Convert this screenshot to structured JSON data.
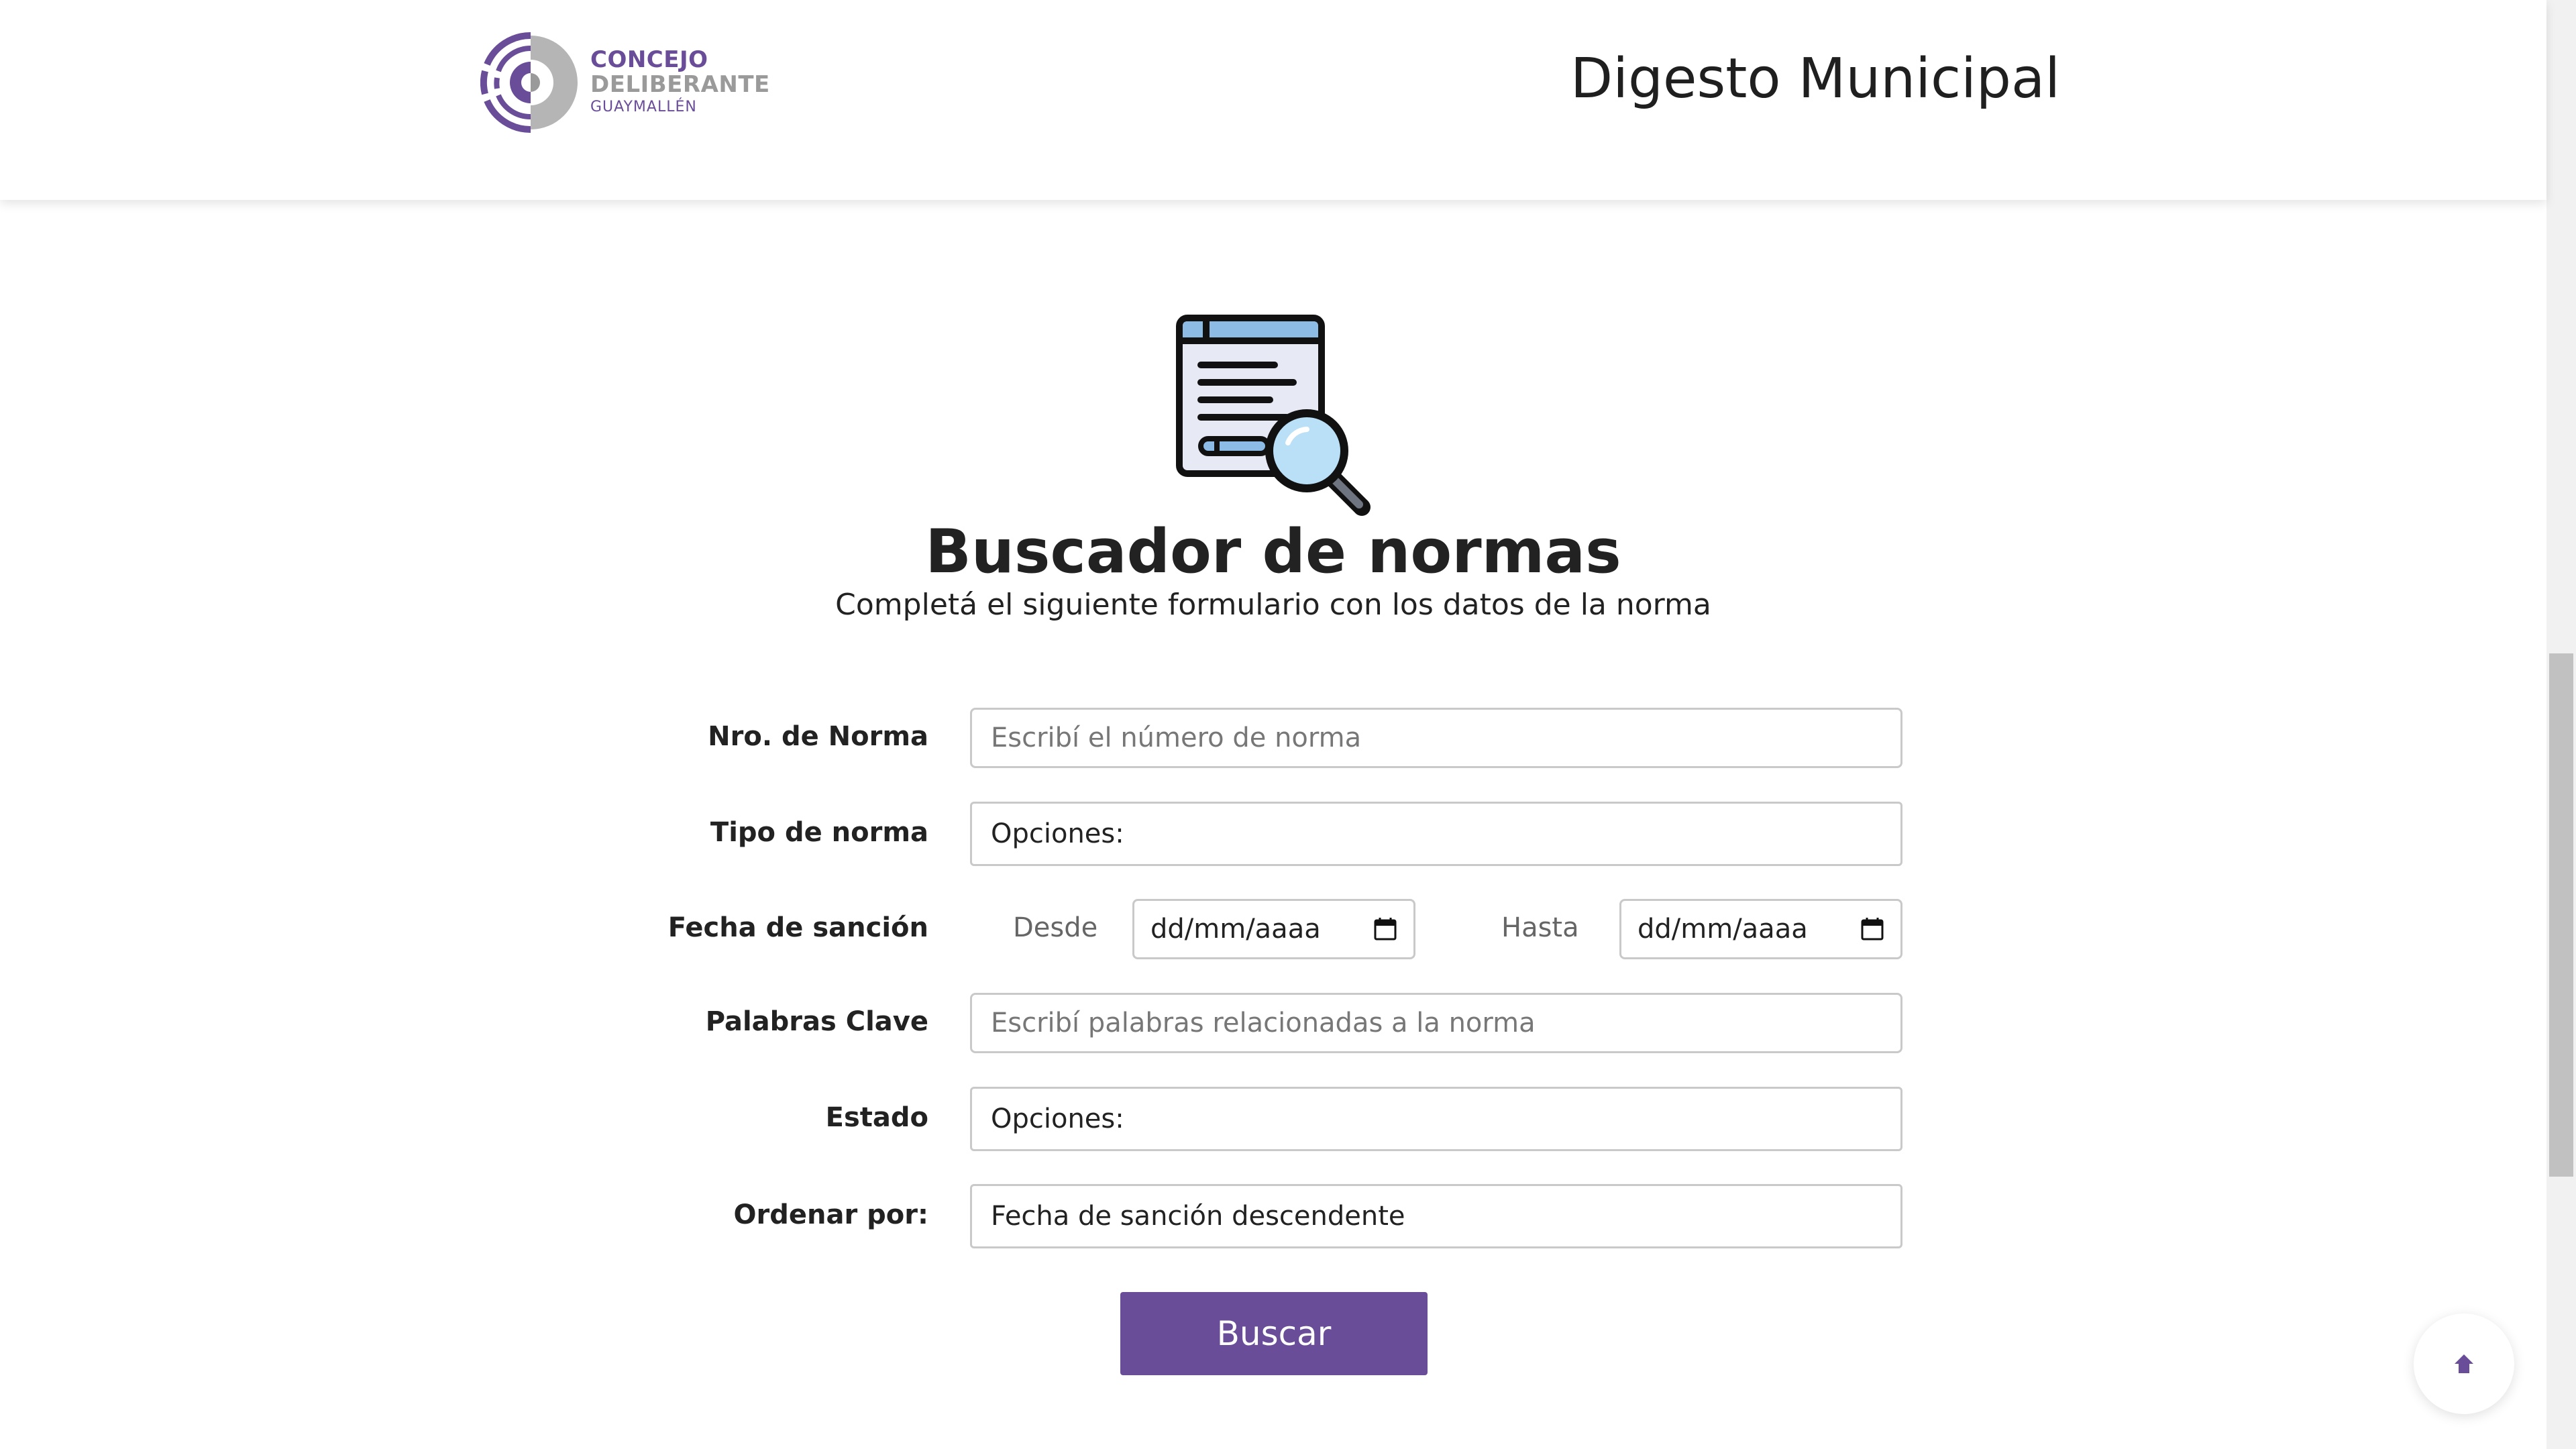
{
  "header": {
    "logo": {
      "line1": "CONCEJO",
      "line2": "DELIBERANTE",
      "line3": "GUAYMALLÉN"
    },
    "site_title": "Digesto Municipal"
  },
  "hero": {
    "icon": "document-search-icon",
    "title": "Buscador de normas",
    "subtitle": "Completá el siguiente formulario con los datos de la norma"
  },
  "form": {
    "numero": {
      "label": "Nro. de Norma",
      "placeholder": "Escribí el número de norma",
      "value": ""
    },
    "tipo": {
      "label": "Tipo de norma",
      "value": "Opciones:"
    },
    "fecha": {
      "label": "Fecha de sanción",
      "desde_label": "Desde",
      "desde_value": "dd/mm/aaaa",
      "hasta_label": "Hasta",
      "hasta_value": "dd/mm/aaaa",
      "icon": "calendar-icon"
    },
    "palabras": {
      "label": "Palabras Clave",
      "placeholder": "Escribí palabras relacionadas a la norma",
      "value": ""
    },
    "estado": {
      "label": "Estado",
      "value": "Opciones:"
    },
    "orden": {
      "label": "Ordenar por:",
      "value": "Fecha de sanción descendente"
    },
    "submit_label": "Buscar"
  },
  "back_to_top": {
    "icon": "arrow-up-icon"
  },
  "colors": {
    "brand": "#6a4d98",
    "logo_gray": "#9a9a9a",
    "icon_blue": "#8cbbe6",
    "icon_light_blue": "#b9e0f6"
  }
}
